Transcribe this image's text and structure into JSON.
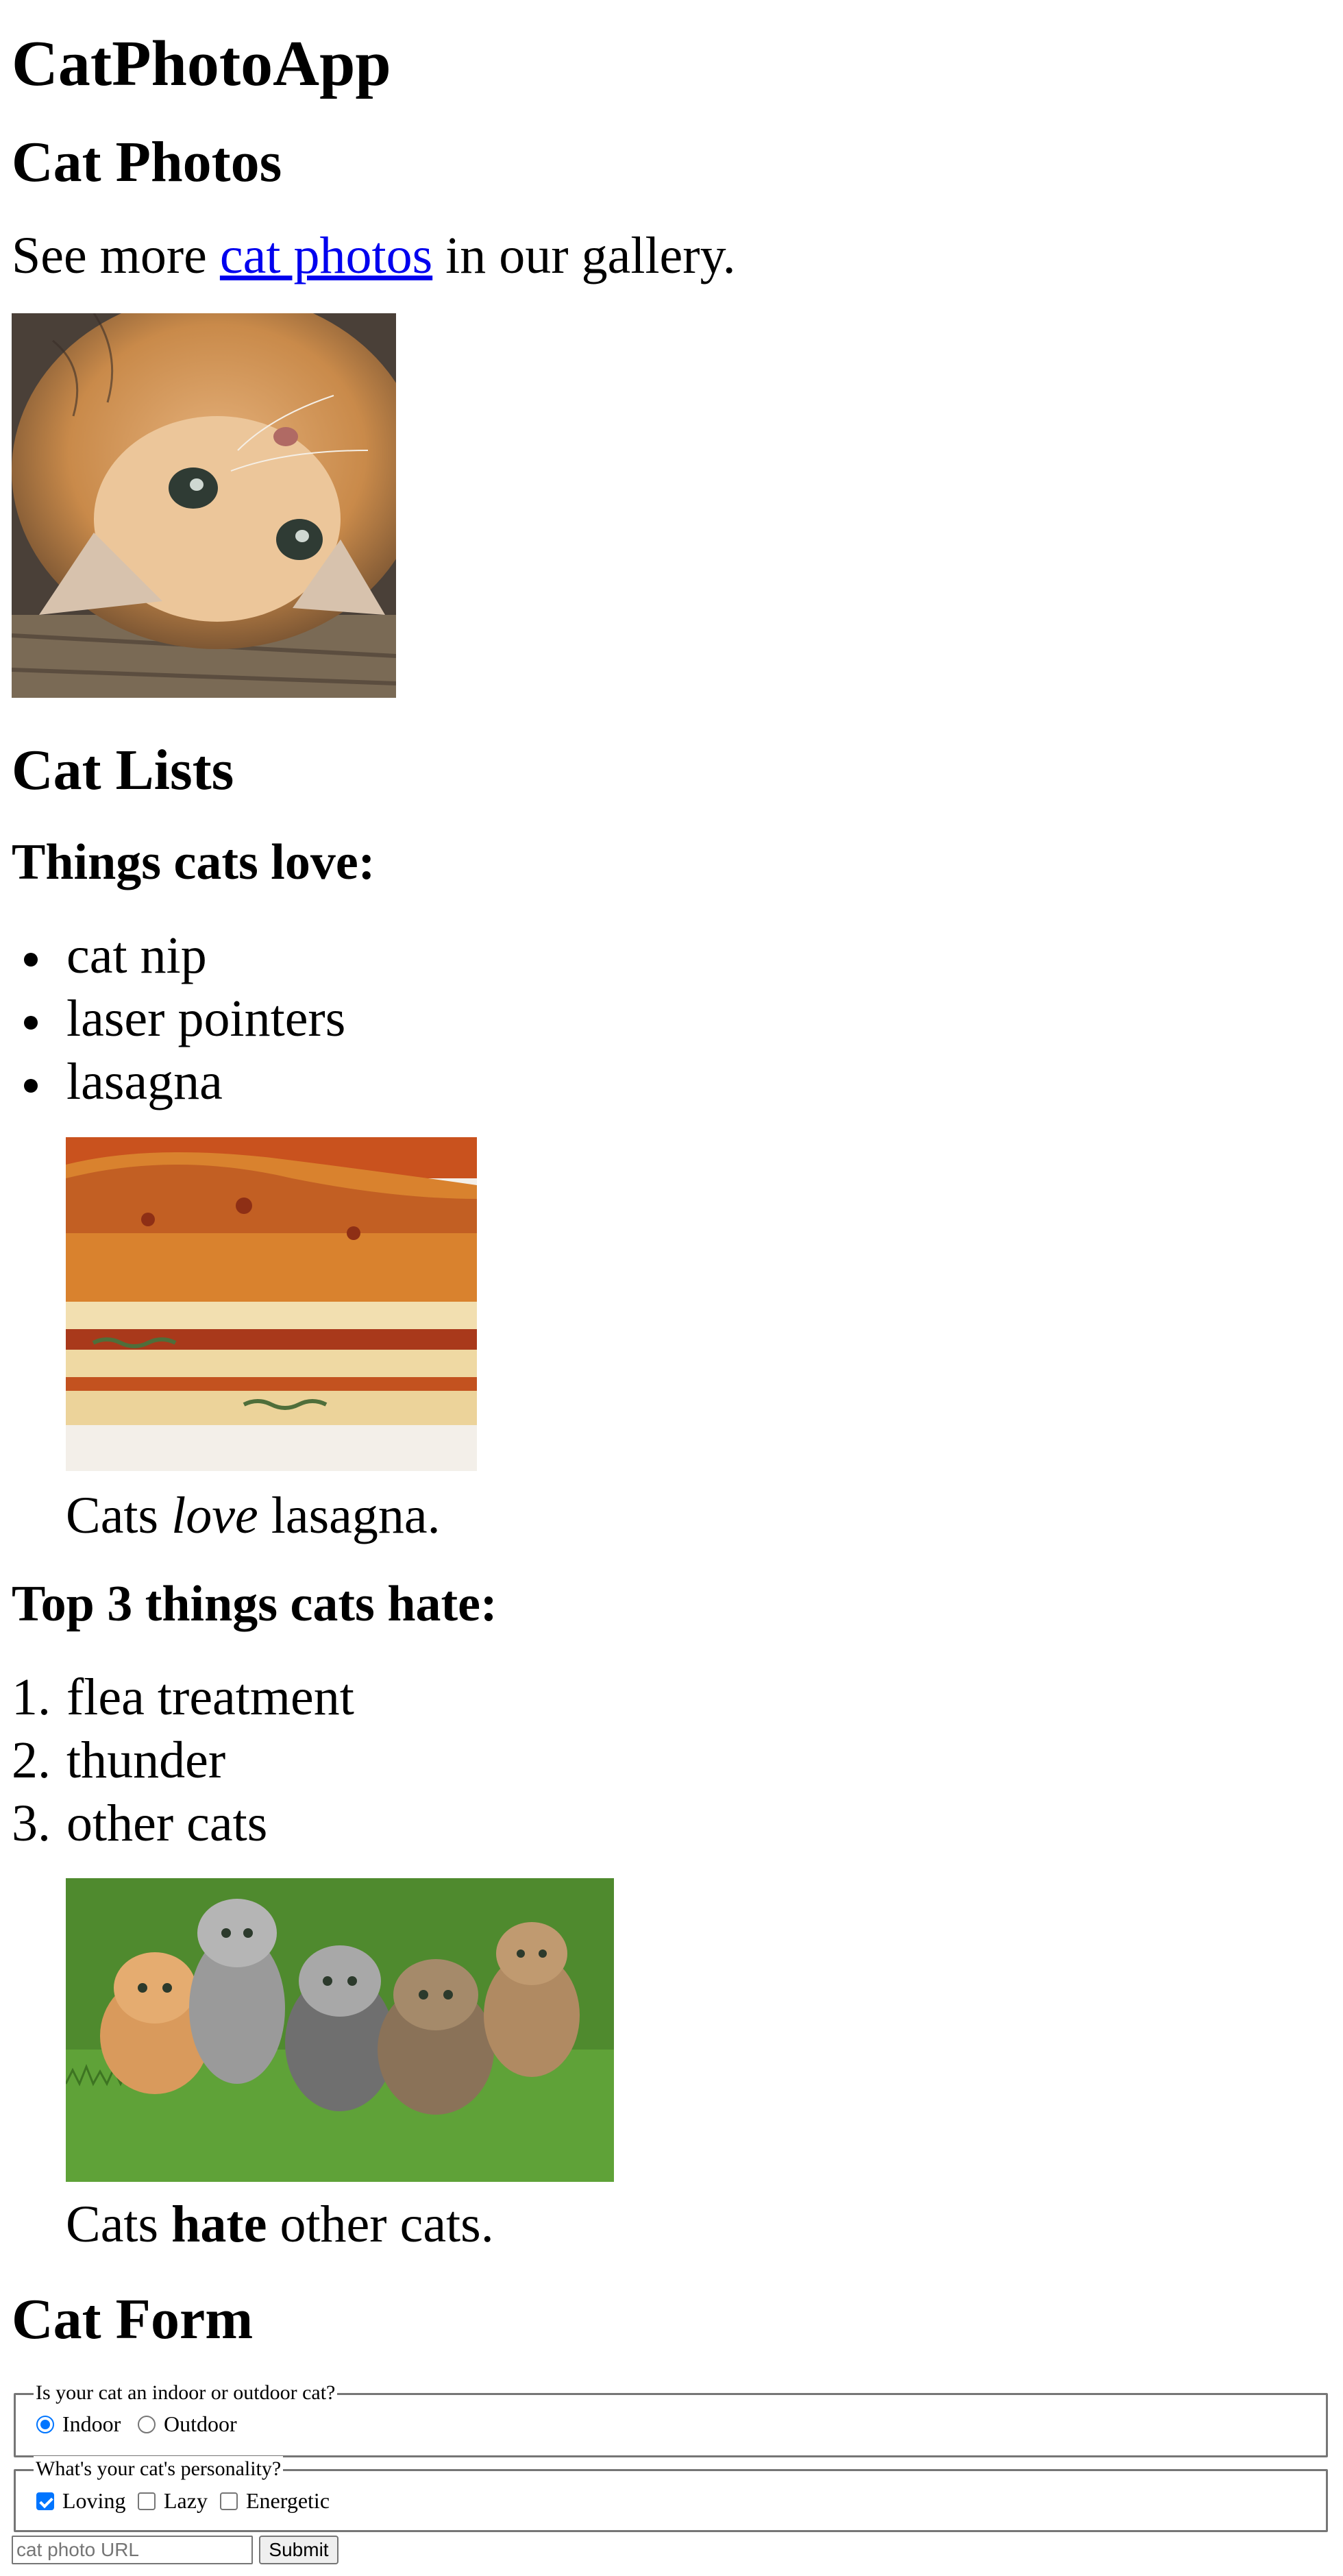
{
  "app_title": "CatPhotoApp",
  "photos_section": {
    "heading": "Cat Photos",
    "text_before": "See more ",
    "link_text": "cat photos",
    "text_after": " in our gallery."
  },
  "lists_section": {
    "heading": "Cat Lists",
    "love_heading": "Things cats love:",
    "love_items": [
      "cat nip",
      "laser pointers",
      "lasagna"
    ],
    "love_caption": {
      "before": "Cats ",
      "emphasis": "love",
      "after": " lasagna."
    },
    "hate_heading": "Top 3 things cats hate:",
    "hate_items": [
      {
        "num": "1.",
        "label": "flea treatment"
      },
      {
        "num": "2.",
        "label": "thunder"
      },
      {
        "num": "3.",
        "label": "other cats"
      }
    ],
    "hate_caption": {
      "before": "Cats ",
      "strong": "hate",
      "after": " other cats."
    }
  },
  "form_section": {
    "heading": "Cat Form",
    "location": {
      "legend": "Is your cat an indoor or outdoor cat?",
      "options": [
        "Indoor",
        "Outdoor"
      ],
      "selected": "Indoor"
    },
    "personality": {
      "legend": "What's your cat's personality?",
      "options": [
        "Loving",
        "Lazy",
        "Energetic"
      ],
      "checked": [
        "Loving"
      ]
    },
    "url_placeholder": "cat photo URL",
    "submit_label": "Submit"
  },
  "colors": {
    "link": "#0000ee",
    "control_accent": "#0075ff"
  }
}
